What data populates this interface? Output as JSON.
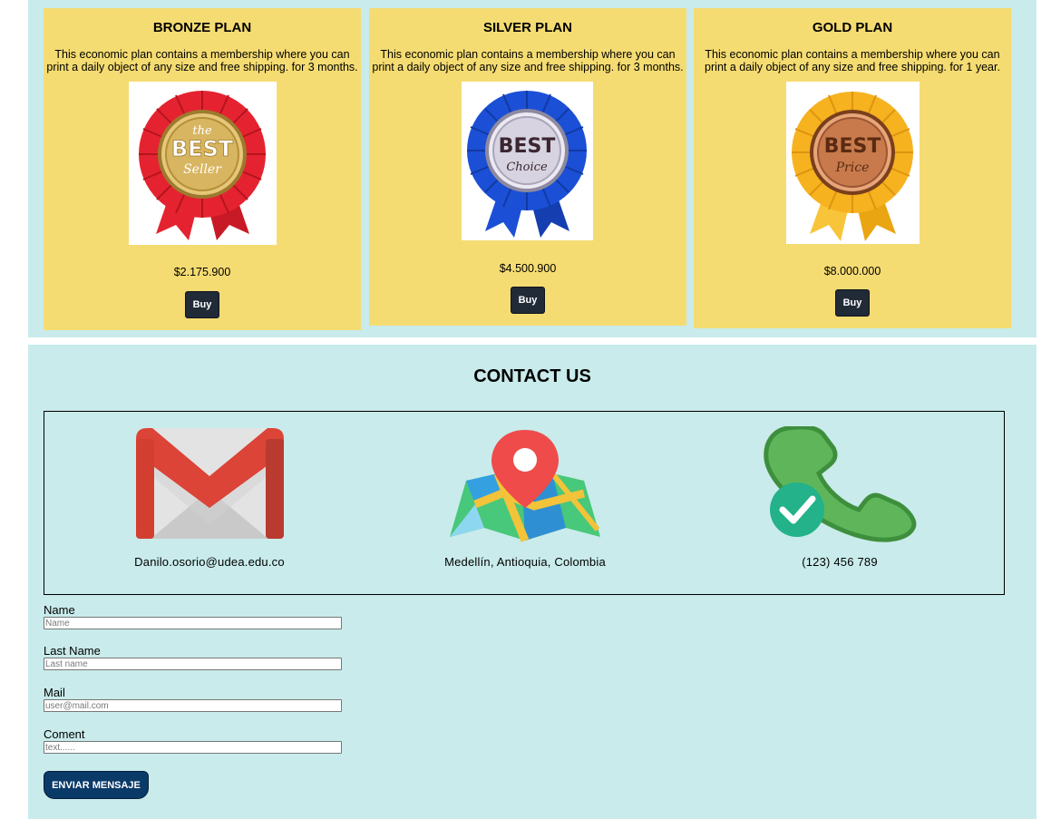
{
  "plans": [
    {
      "title": "BRONZE PLAN",
      "description": "This economic plan contains a membership where you can print a daily object of any size and free shipping. for 3 months.",
      "image_icon": "best-seller-ribbon-icon",
      "badge_top": "the",
      "badge_main": "BEST",
      "badge_bottom": "Seller",
      "price": "$2.175.900",
      "buy_label": "Buy",
      "ribbon_color": "#e52330",
      "medal_color": "#d8b560"
    },
    {
      "title": "SILVER PLAN",
      "description": "This economic plan contains a membership where you can print a daily object of any size and free shipping. for 3 months.",
      "image_icon": "best-choice-ribbon-icon",
      "badge_main": "BEST",
      "badge_bottom": "Choice",
      "price": "$4.500.900",
      "buy_label": "Buy",
      "ribbon_color": "#1b4fd6",
      "medal_color": "#d7d3e0"
    },
    {
      "title": "GOLD PLAN",
      "description": "This economic plan contains a membership where you can print a daily object of any size and free shipping. for 1 year.",
      "image_icon": "best-price-ribbon-icon",
      "badge_main": "BEST",
      "badge_bottom": "Price",
      "price": "$8.000.000",
      "buy_label": "Buy",
      "ribbon_color": "#f6b21f",
      "medal_color": "#c87a4c"
    }
  ],
  "contact": {
    "title": "CONTACT US",
    "items": [
      {
        "icon": "gmail-icon",
        "text": "Danilo.osorio@udea.edu.co"
      },
      {
        "icon": "map-pin-icon",
        "text": "Medellín, Antioquia, Colombia"
      },
      {
        "icon": "phone-check-icon",
        "text": "(123) 456 789"
      }
    ]
  },
  "form": {
    "fields": [
      {
        "label": "Name",
        "placeholder": "Name",
        "value": ""
      },
      {
        "label": "Last Name",
        "placeholder": "Last name",
        "value": ""
      },
      {
        "label": "Mail",
        "placeholder": "user@mail.com",
        "value": ""
      },
      {
        "label": "Coment",
        "placeholder": "text......",
        "value": ""
      }
    ],
    "submit_label": "ENVIAR MENSAJE"
  },
  "colors": {
    "section_bg": "#c9ebeb",
    "card_bg": "#f5dc72",
    "buy_button": "#212a37",
    "submit_button": "#0a3a68"
  }
}
